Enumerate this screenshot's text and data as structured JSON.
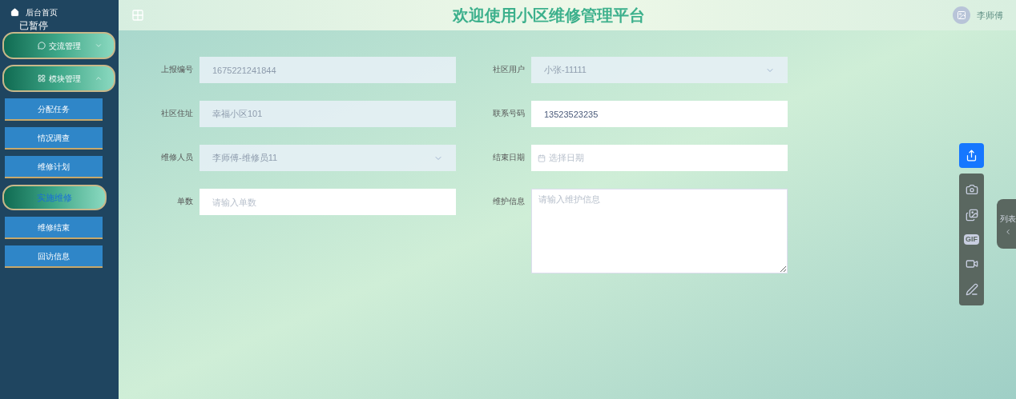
{
  "sidebar": {
    "home": "后台首页",
    "overlay_text": "已暂停",
    "groups": [
      {
        "label": "交流管理",
        "expanded": false
      },
      {
        "label": "模块管理",
        "expanded": true,
        "children": [
          {
            "label": "分配任务",
            "selected": false
          },
          {
            "label": "情况调查",
            "selected": false
          },
          {
            "label": "维修计划",
            "selected": false
          },
          {
            "label": "实施维修",
            "selected": true
          },
          {
            "label": "维修结束",
            "selected": false
          },
          {
            "label": "回访信息",
            "selected": false
          }
        ]
      }
    ]
  },
  "header": {
    "title": "欢迎使用小区维修管理平台",
    "user": "李师傅"
  },
  "form": {
    "left": [
      {
        "label": "上报编号",
        "kind": "input",
        "value": "1675221241844",
        "disabled": true
      },
      {
        "label": "社区住址",
        "kind": "input",
        "value": "幸福小区101",
        "disabled": true
      },
      {
        "label": "维修人员",
        "kind": "select",
        "value": "李师傅-维修员11",
        "disabled": true
      },
      {
        "label": "单数",
        "kind": "input",
        "placeholder": "请输入单数",
        "disabled": false
      }
    ],
    "right": [
      {
        "label": "社区用户",
        "kind": "select",
        "value": "小张-11111",
        "disabled": true
      },
      {
        "label": "联系号码",
        "kind": "input",
        "value": "13523523235",
        "disabled": false
      },
      {
        "label": "结束日期",
        "kind": "date",
        "placeholder": "选择日期",
        "disabled": false
      },
      {
        "label": "维护信息",
        "kind": "textarea",
        "placeholder": "请输入维护信息",
        "disabled": false
      }
    ]
  },
  "toolbar": {
    "gif_label": "GIF"
  },
  "side_tab": {
    "label": "列表",
    "expanded": false
  }
}
